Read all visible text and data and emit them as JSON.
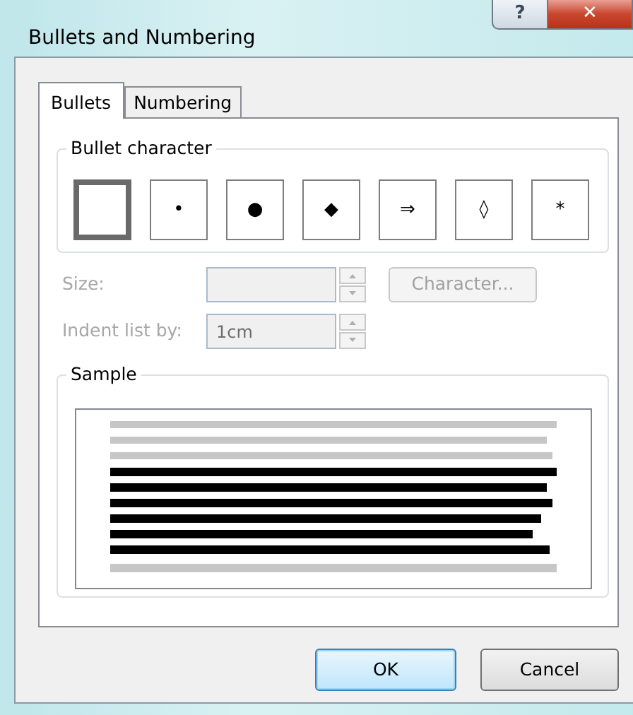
{
  "window": {
    "title": "Bullets and Numbering",
    "help": "?",
    "close": "✕"
  },
  "tabs": [
    {
      "label": "Bullets",
      "selected": true
    },
    {
      "label": "Numbering",
      "selected": false
    }
  ],
  "bullet_group": {
    "title": "Bullet character",
    "items": [
      {
        "selected": true
      },
      {
        "char": "•",
        "selected": false
      },
      {
        "char": "●",
        "selected": false
      },
      {
        "char": "◆",
        "selected": false
      },
      {
        "char": "⇒",
        "selected": false
      },
      {
        "char": "◊",
        "selected": false
      },
      {
        "char": "*",
        "selected": false
      }
    ]
  },
  "size": {
    "label": "Size:",
    "disabled": true
  },
  "character_button": {
    "label": "Character...",
    "disabled": true
  },
  "indent": {
    "label": "Indent list by:",
    "value": "1cm",
    "disabled": true
  },
  "sample": {
    "title": "Sample"
  },
  "buttons": [
    {
      "label": "OK",
      "default": true
    },
    {
      "label": "Cancel",
      "default": false
    }
  ]
}
